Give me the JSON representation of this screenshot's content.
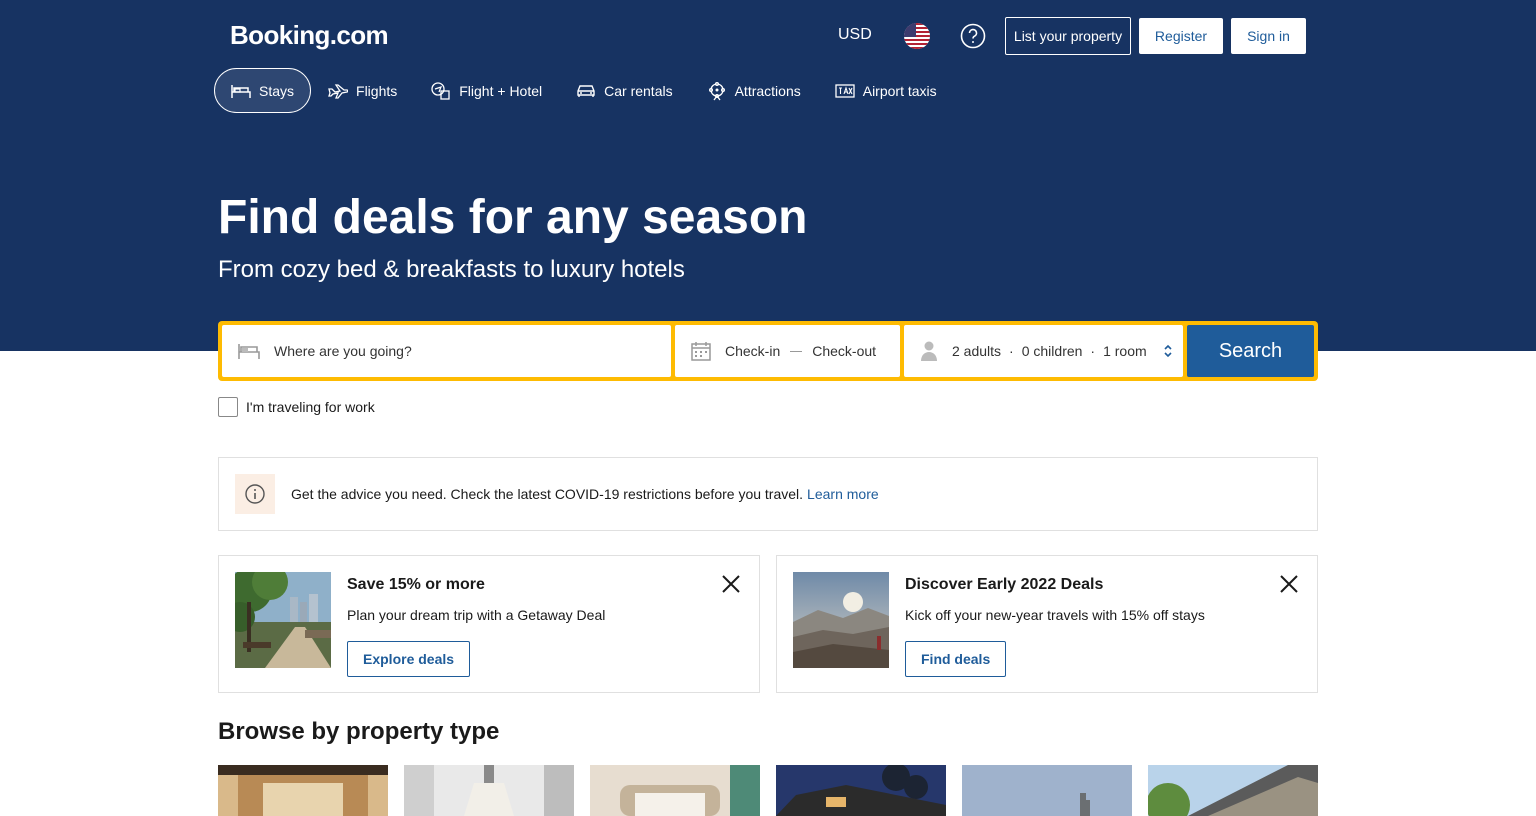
{
  "header": {
    "logo": "Booking.com",
    "currency": "USD",
    "list_property": "List your property",
    "register": "Register",
    "sign_in": "Sign in"
  },
  "nav": {
    "items": [
      {
        "label": "Stays",
        "icon": "bed-icon",
        "active": true
      },
      {
        "label": "Flights",
        "icon": "plane-icon"
      },
      {
        "label": "Flight + Hotel",
        "icon": "flight-hotel-icon"
      },
      {
        "label": "Car rentals",
        "icon": "car-icon"
      },
      {
        "label": "Attractions",
        "icon": "attractions-icon"
      },
      {
        "label": "Airport taxis",
        "icon": "taxi-icon"
      }
    ]
  },
  "hero": {
    "title": "Find deals for any season",
    "subtitle": "From cozy bed & breakfasts to luxury hotels"
  },
  "search": {
    "destination_placeholder": "Where are you going?",
    "check_in": "Check-in",
    "check_out": "Check-out",
    "adults": "2 adults",
    "children": "0 children",
    "rooms": "1 room",
    "separator": "·",
    "button": "Search"
  },
  "work_travel": {
    "label": "I'm traveling for work",
    "checked": false
  },
  "notice": {
    "text": "Get the advice you need. Check the latest COVID-19 restrictions before you travel.",
    "link": "Learn more"
  },
  "promos": [
    {
      "title": "Save 15% or more",
      "text": "Plan your dream trip with a Getaway Deal",
      "button": "Explore deals"
    },
    {
      "title": "Discover Early 2022 Deals",
      "text": "Kick off your new-year travels with 15% off stays",
      "button": "Find deals"
    }
  ],
  "browse": {
    "title": "Browse by property type"
  },
  "colors": {
    "brand_blue": "#173362",
    "link_blue": "#1f5c9a",
    "search_yellow": "#febb02"
  }
}
